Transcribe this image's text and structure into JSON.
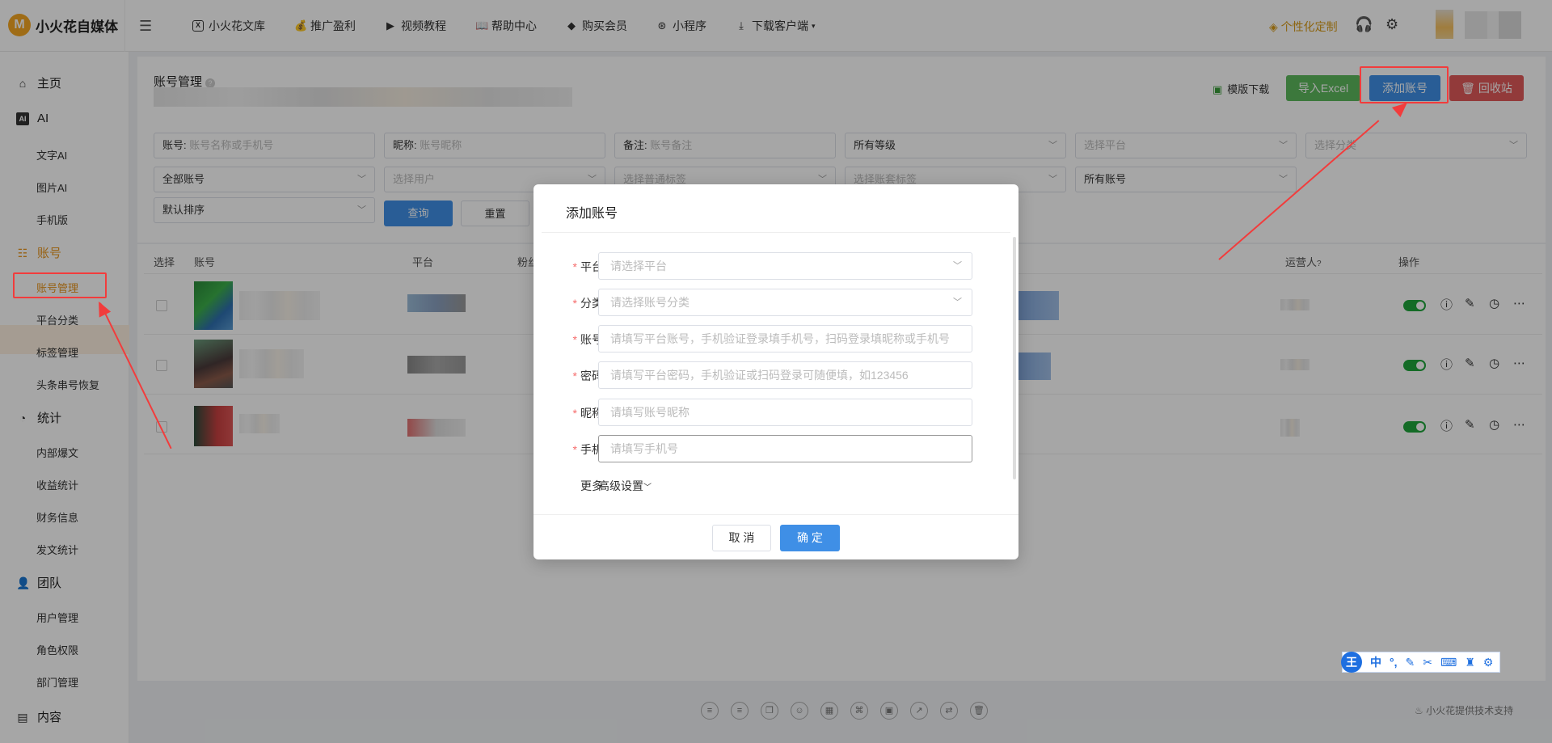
{
  "app": {
    "logo_letter": "M",
    "name": "小火花自媒体"
  },
  "topnav": [
    {
      "label": "小火花文库",
      "icon": "library-icon"
    },
    {
      "label": "推广盈利",
      "icon": "money-bag-icon"
    },
    {
      "label": "视频教程",
      "icon": "video-icon"
    },
    {
      "label": "帮助中心",
      "icon": "book-icon"
    },
    {
      "label": "购买会员",
      "icon": "diamond-icon"
    },
    {
      "label": "小程序",
      "icon": "miniprogram-icon"
    },
    {
      "label": "下载客户端",
      "icon": "download-icon"
    }
  ],
  "topright": {
    "custom": "个性化定制"
  },
  "sidebar": {
    "home": "主页",
    "ai": "AI",
    "ai_items": [
      "文字AI",
      "图片AI",
      "手机版"
    ],
    "account": "账号",
    "account_items": [
      "账号管理",
      "平台分类",
      "标签管理",
      "头条串号恢复"
    ],
    "stats": "统计",
    "stats_items": [
      "内部爆文",
      "收益统计",
      "财务信息",
      "发文统计"
    ],
    "team": "团队",
    "team_items": [
      "用户管理",
      "角色权限",
      "部门管理"
    ],
    "content": "内容"
  },
  "page": {
    "title": "账号管理",
    "template_download": "模版下载",
    "import_excel": "导入Excel",
    "add_account": "添加账号",
    "recycle": "回收站"
  },
  "filters": {
    "account_label": "账号:",
    "account_ph": "账号名称或手机号",
    "nickname_label": "昵称:",
    "nickname_ph": "账号昵称",
    "remark_label": "备注:",
    "remark_ph": "账号备注",
    "level": "所有等级",
    "platform_ph": "选择平台",
    "category_ph": "选择分类",
    "all_accounts": "全部账号",
    "user_ph": "选择用户",
    "tag_ph": "选择普通标签",
    "acct_tag_ph": "选择账套标签",
    "all_accounts2": "所有账号",
    "sort": "默认排序",
    "query": "查询",
    "reset": "重置"
  },
  "table": {
    "headers": {
      "select": "选择",
      "account": "账号",
      "platform": "平台",
      "fans": "粉丝",
      "operator": "运营人",
      "actions": "操作"
    }
  },
  "modal": {
    "title": "添加账号",
    "fields": [
      {
        "label": "平台",
        "placeholder": "请选择平台",
        "select": true
      },
      {
        "label": "分类",
        "placeholder": "请选择账号分类",
        "select": true
      },
      {
        "label": "账号",
        "placeholder": "请填写平台账号，手机验证登录填手机号，扫码登录填昵称或手机号",
        "select": false
      },
      {
        "label": "密码",
        "placeholder": "请填写平台密码，手机验证或扫码登录可随便填，如123456",
        "select": false
      },
      {
        "label": "昵称",
        "placeholder": "请填写账号昵称",
        "select": false
      },
      {
        "label": "手机",
        "placeholder": "请填写手机号",
        "select": false
      }
    ],
    "more_label": "更多",
    "advanced": "高级设置",
    "cancel": "取 消",
    "confirm": "确 定"
  },
  "ime": {
    "logo": "王",
    "mode": "中"
  },
  "footer": "小火花提供技术支持",
  "colors": {
    "accent": "#e8951e",
    "primary": "#3f8fe6",
    "success": "#5cb85c",
    "danger": "#e05a5a",
    "annotation": "#f23c3c"
  }
}
